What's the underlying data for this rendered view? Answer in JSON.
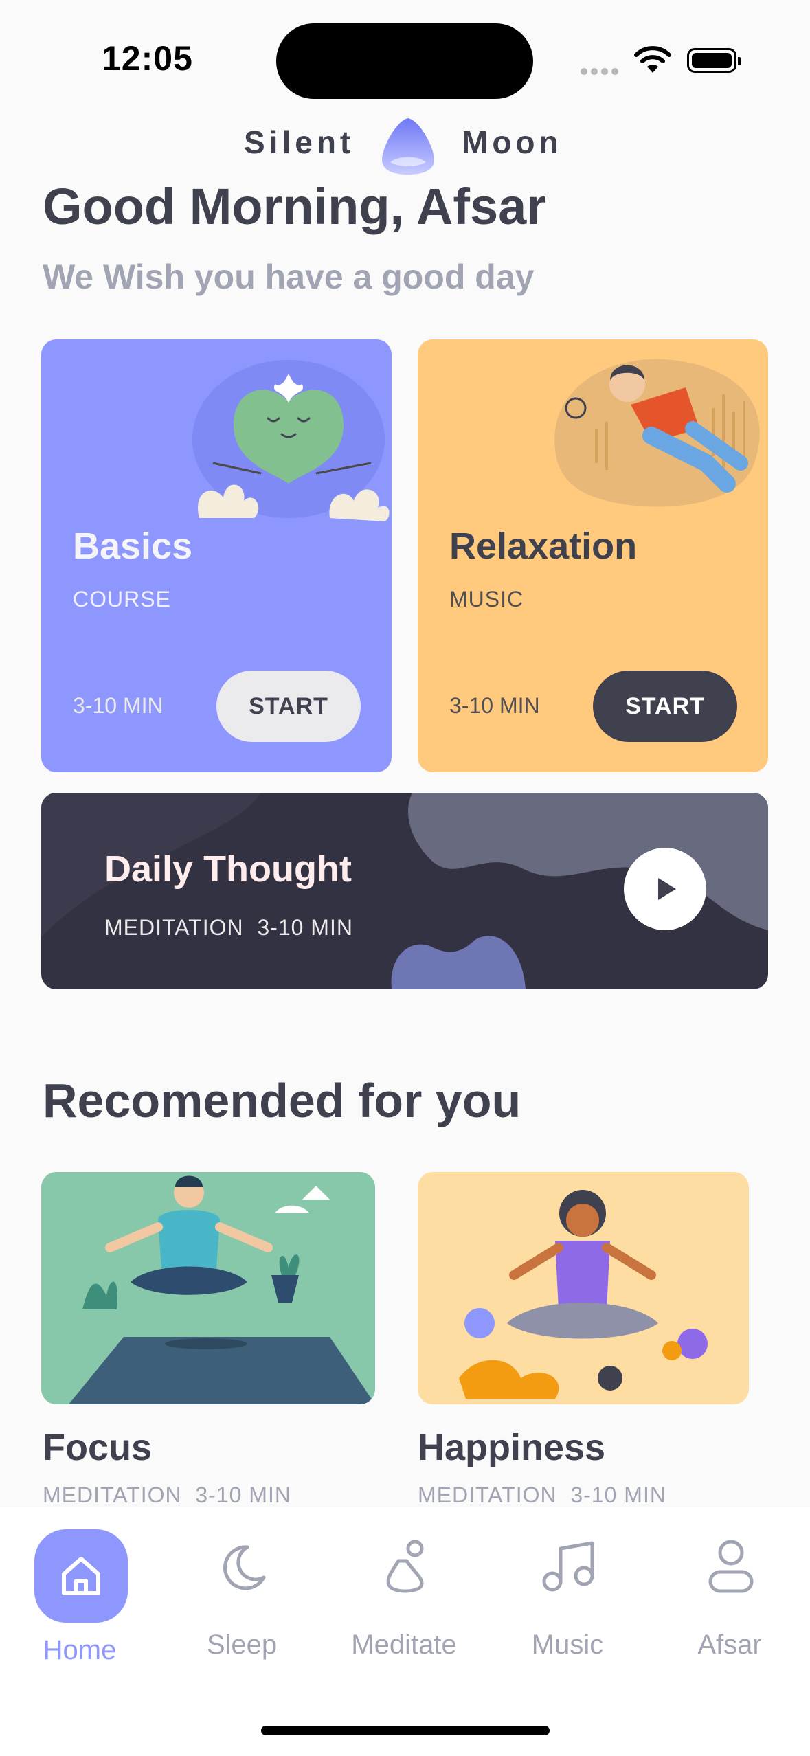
{
  "status_bar": {
    "time": "12:05"
  },
  "brand": {
    "left": "Silent",
    "right": "Moon"
  },
  "greeting": {
    "title": "Good Morning, Afsar",
    "subtitle": "We Wish you have a good day"
  },
  "cards": [
    {
      "title": "Basics",
      "category": "COURSE",
      "duration": "3-10 MIN",
      "button": "START"
    },
    {
      "title": "Relaxation",
      "category": "MUSIC",
      "duration": "3-10 MIN",
      "button": "START"
    }
  ],
  "daily": {
    "title": "Daily Thought",
    "meta": "MEDITATION  3-10 MIN"
  },
  "recommended": {
    "title": "Recomended for you",
    "items": [
      {
        "title": "Focus",
        "meta": "MEDITATION  3-10 MIN"
      },
      {
        "title": "Happiness",
        "meta": "MEDITATION  3-10 MIN"
      }
    ]
  },
  "nav": {
    "items": [
      {
        "label": "Home",
        "icon": "home-icon",
        "active": true
      },
      {
        "label": "Sleep",
        "icon": "moon-icon",
        "active": false
      },
      {
        "label": "Meditate",
        "icon": "meditate-icon",
        "active": false
      },
      {
        "label": "Music",
        "icon": "music-icon",
        "active": false
      },
      {
        "label": "Afsar",
        "icon": "user-icon",
        "active": false
      }
    ]
  },
  "colors": {
    "accent": "#8e97fd",
    "orange": "#ffc97e",
    "dark": "#3f414e",
    "muted": "#a1a4b2"
  }
}
